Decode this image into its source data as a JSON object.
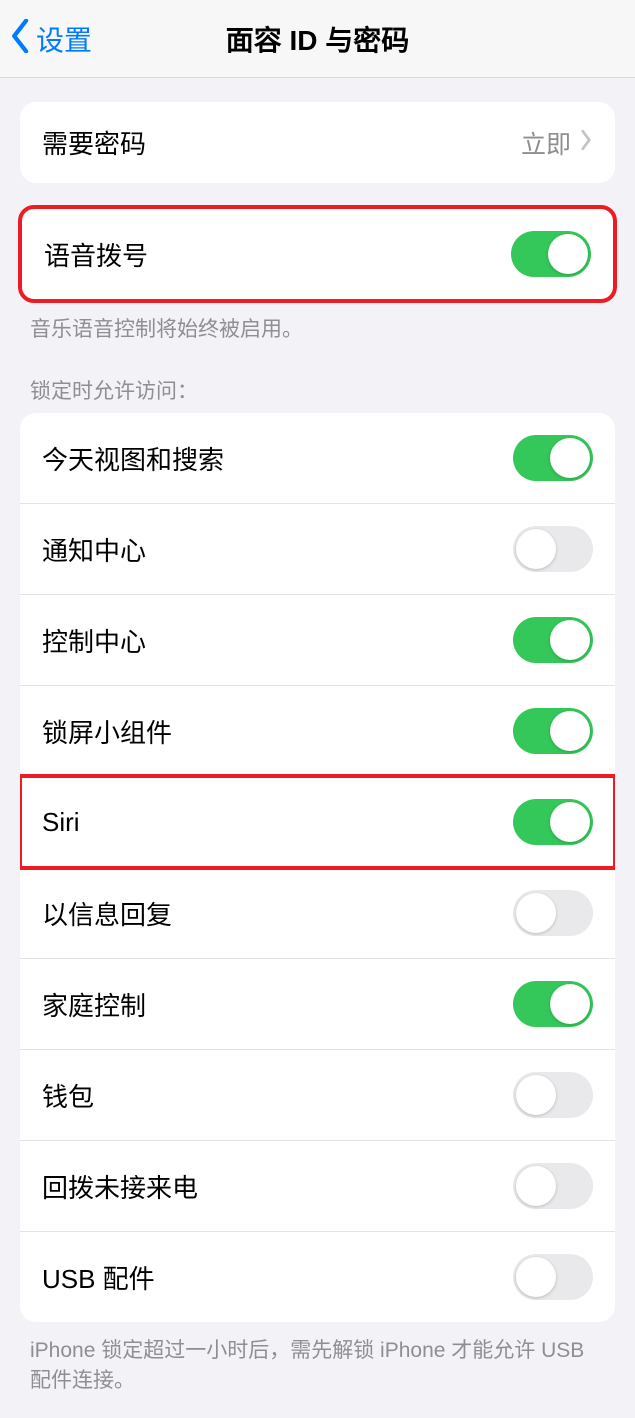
{
  "header": {
    "back_label": "设置",
    "title": "面容 ID 与密码"
  },
  "require_passcode": {
    "label": "需要密码",
    "value": "立即"
  },
  "voice_dial": {
    "label": "语音拨号",
    "on": true,
    "footnote": "音乐语音控制将始终被启用。"
  },
  "lock_access": {
    "header": "锁定时允许访问：",
    "items": [
      {
        "label": "今天视图和搜索",
        "on": true
      },
      {
        "label": "通知中心",
        "on": false
      },
      {
        "label": "控制中心",
        "on": true
      },
      {
        "label": "锁屏小组件",
        "on": true
      },
      {
        "label": "Siri",
        "on": true
      },
      {
        "label": "以信息回复",
        "on": false
      },
      {
        "label": "家庭控制",
        "on": true
      },
      {
        "label": "钱包",
        "on": false
      },
      {
        "label": "回拨未接来电",
        "on": false
      },
      {
        "label": "USB 配件",
        "on": false
      }
    ],
    "footnote": "iPhone 锁定超过一小时后，需先解锁 iPhone 才能允许 USB 配件连接。"
  }
}
